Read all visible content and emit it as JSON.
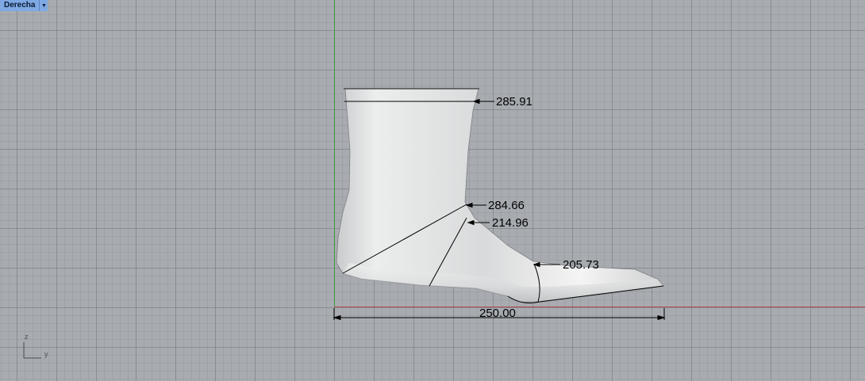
{
  "viewport": {
    "name": "Derecha",
    "menu_icon": "chevron-down-icon"
  },
  "axes": {
    "x_color": "#b34a4a",
    "z_color": "#3a9a3a"
  },
  "dimensions": {
    "top_circumference": "285.91",
    "instep_circumference": "284.66",
    "heel_circumference": "214.96",
    "ball_circumference": "205.73",
    "length": "250.00"
  },
  "axis_icon": {
    "z_label": "z",
    "y_label": "y"
  }
}
